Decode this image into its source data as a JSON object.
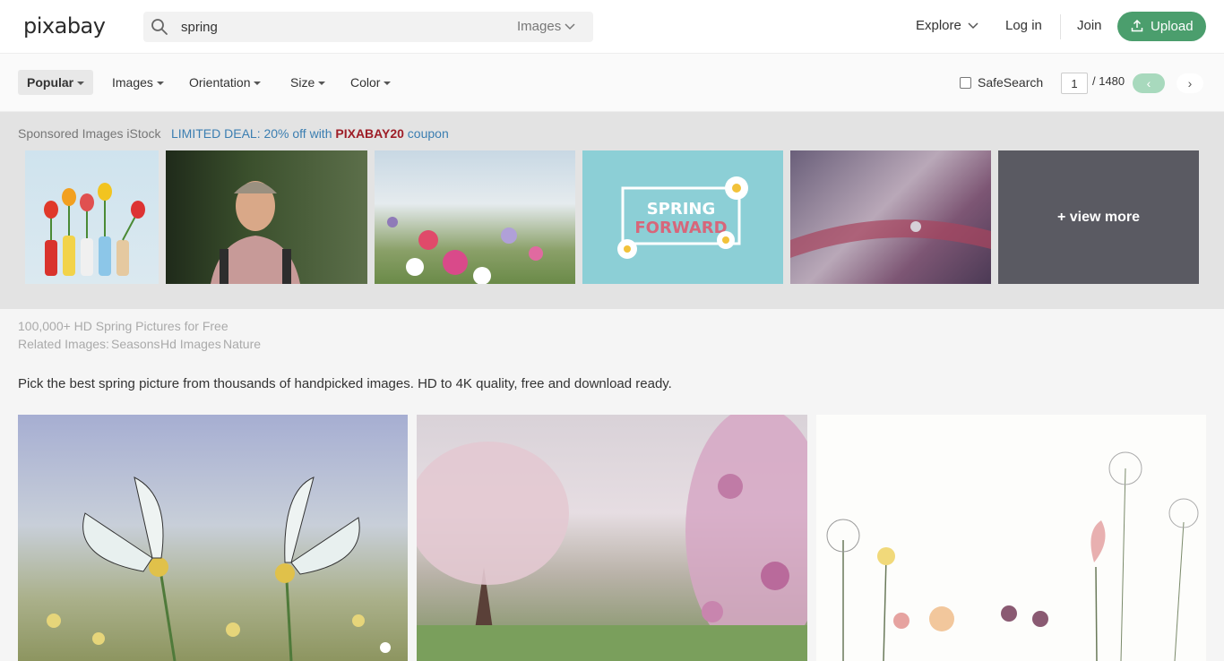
{
  "header": {
    "logo": "pixabay",
    "search_value": "spring",
    "search_type": "Images",
    "explore": "Explore",
    "login": "Log in",
    "join": "Join",
    "upload": "Upload",
    "upload_color": "#4b9e6d"
  },
  "filters": {
    "popular": "Popular",
    "images": "Images",
    "orientation": "Orientation",
    "size": "Size",
    "color": "Color",
    "safesearch": "SafeSearch",
    "page_current": "1",
    "page_total": "/ 1480",
    "prev": "‹",
    "next": "›"
  },
  "sponsored": {
    "label": "Sponsored Images iStock",
    "deal_prefix": "LIMITED DEAL: 20% off with ",
    "deal_code": "PIXABAY20",
    "deal_suffix": " coupon",
    "thumb4_line1": "SPRING",
    "thumb4_line2": "FORWARD",
    "view_more": "+ view more"
  },
  "info": {
    "title": "100,000+ HD Spring Pictures for Free",
    "related_label": "Related Images:",
    "related_tags": [
      "Seasons",
      "Hd Images",
      "Nature"
    ],
    "description": "Pick the best spring picture from thousands of handpicked images. HD to 4K quality, free and download ready."
  }
}
